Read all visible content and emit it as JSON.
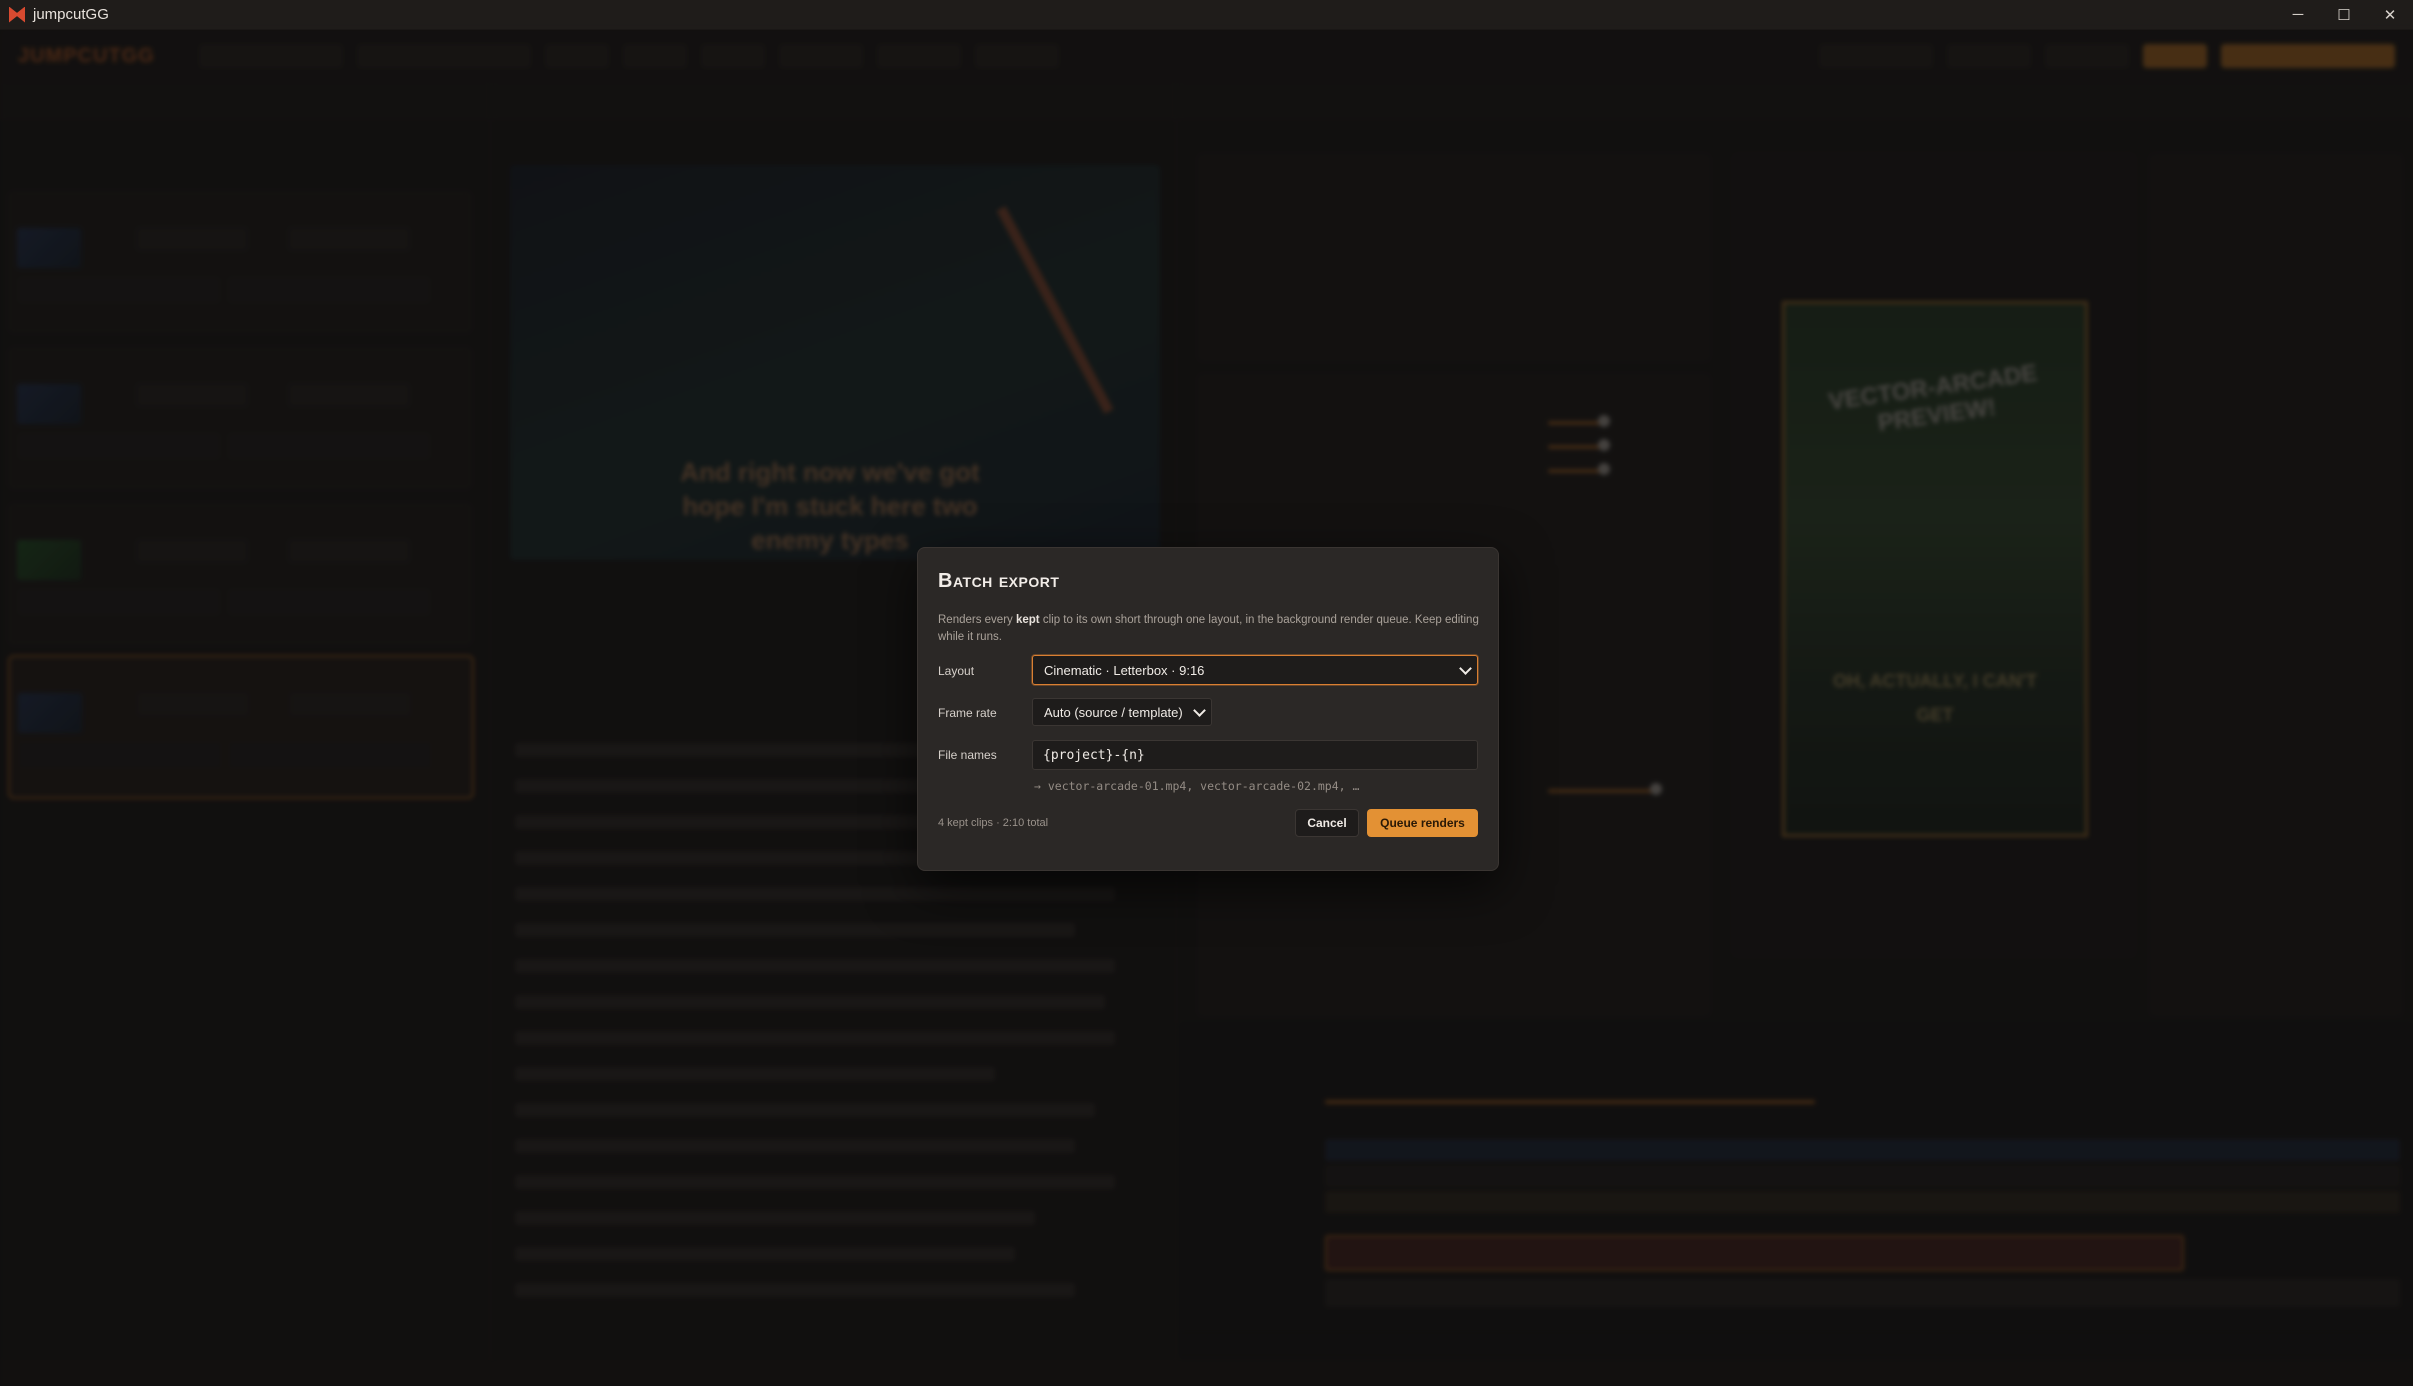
{
  "window": {
    "title": "jumpcutGG",
    "controls": {
      "minimize": "─",
      "maximize": "☐",
      "close": "✕"
    }
  },
  "app_background": {
    "logo": "JUMPCUTGG",
    "caption_preview": "And right now we've got hope I'm stuck here two enemy types",
    "vertical_preview_title": "VECTOR-ARCADE PREVIEW!",
    "vertical_preview_subtitle": "OH, ACTUALLY, I CAN'T GET"
  },
  "modal": {
    "title": "Batch export",
    "description_before": "Renders every ",
    "description_bold": "kept",
    "description_after": " clip to its own short through one layout, in the background render queue. Keep editing while it runs.",
    "layout": {
      "label": "Layout",
      "value": "Cinematic · Letterbox · 9:16"
    },
    "frame_rate": {
      "label": "Frame rate",
      "value": "Auto (source / template)"
    },
    "file_names": {
      "label": "File names",
      "value": "{project}-{n}",
      "preview": "→ vector-arcade-01.mp4, vector-arcade-02.mp4, …"
    },
    "summary": "4 kept clips · 2:10 total",
    "cancel_label": "Cancel",
    "queue_label": "Queue renders"
  },
  "colors": {
    "accent": "#e39134",
    "focus_border": "#d97f32",
    "modal_bg": "#2b2826"
  }
}
